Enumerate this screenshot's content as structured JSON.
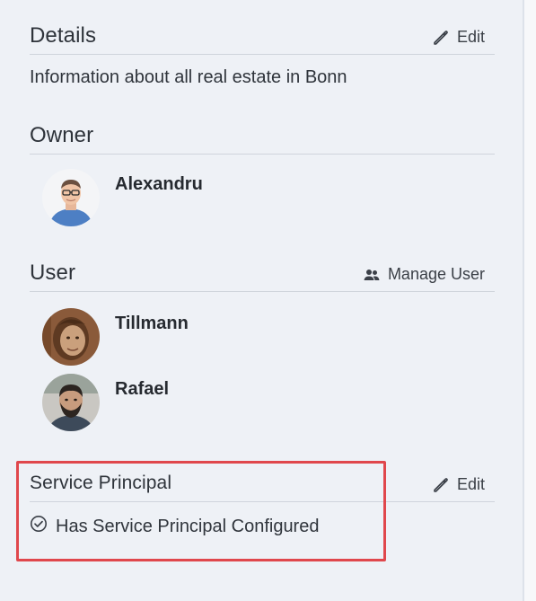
{
  "details": {
    "title": "Details",
    "edit_label": "Edit",
    "description": "Information about all real estate in Bonn"
  },
  "owner": {
    "title": "Owner",
    "people": [
      {
        "name": "Alexandru"
      }
    ]
  },
  "user": {
    "title": "User",
    "manage_label": "Manage User",
    "people": [
      {
        "name": "Tillmann"
      },
      {
        "name": "Rafael"
      }
    ]
  },
  "service_principal": {
    "title": "Service Principal",
    "edit_label": "Edit",
    "status_text": "Has Service Principal Configured"
  },
  "icons": {
    "edit": "pencil-icon",
    "manage_user": "people-icon",
    "status": "check-circle-icon"
  },
  "colors": {
    "background": "#eef1f6",
    "highlight_border": "#e0474c",
    "divider": "#cfd4dc"
  }
}
